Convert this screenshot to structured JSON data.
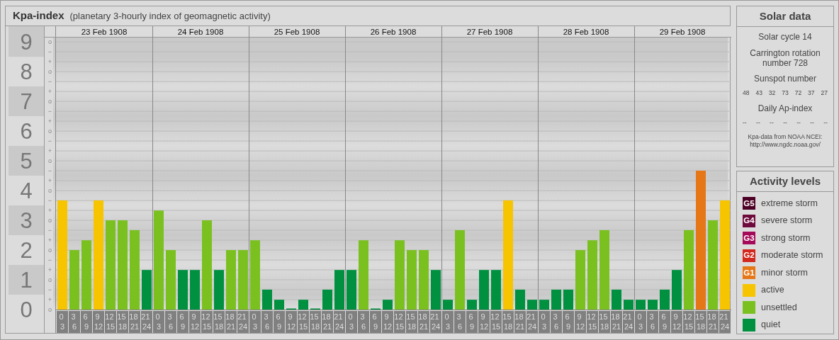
{
  "kpa_panel": {
    "title": "Kpa-index",
    "subtitle": "(planetary 3-hourly index of geomagnetic activity)",
    "days": [
      "23 Feb 1908",
      "24 Feb 1908",
      "25 Feb 1908",
      "26 Feb 1908",
      "27 Feb 1908",
      "28 Feb 1908",
      "29 Feb 1908"
    ],
    "minor_tick_labels": [
      "o",
      "−",
      "+",
      "o",
      "−",
      "+",
      "o",
      "−",
      "+",
      "o",
      "−",
      "+",
      "o",
      "−",
      "+",
      "o",
      "−",
      "+",
      "o",
      "−",
      "+",
      "o",
      "−",
      "+",
      "o",
      "−",
      "+",
      "o"
    ],
    "chart_data": {
      "type": "bar",
      "grid": true,
      "ylim": [
        0,
        9.17
      ],
      "yticks": [
        {
          "value": 0,
          "label": "0"
        },
        {
          "value": 1,
          "label": "1"
        },
        {
          "value": 2,
          "label": "2"
        },
        {
          "value": 3,
          "label": "3"
        },
        {
          "value": 4,
          "label": "4"
        },
        {
          "value": 5,
          "label": "5"
        },
        {
          "value": 6,
          "label": "6"
        },
        {
          "value": 7,
          "label": "7"
        },
        {
          "value": 8,
          "label": "8"
        },
        {
          "value": 9,
          "label": "9"
        }
      ],
      "categories": [
        "0 3",
        "3 6",
        "6 9",
        "9 12",
        "12 15",
        "15 18",
        "18 21",
        "21 24",
        "0 3",
        "3 6",
        "6 9",
        "9 12",
        "12 15",
        "15 18",
        "18 21",
        "21 24",
        "0 3",
        "3 6",
        "6 9",
        "9 12",
        "12 15",
        "15 18",
        "18 21",
        "21 24",
        "0 3",
        "3 6",
        "6 9",
        "9 12",
        "12 15",
        "15 18",
        "18 21",
        "21 24",
        "0 3",
        "3 6",
        "6 9",
        "9 12",
        "12 15",
        "15 18",
        "18 21",
        "21 24",
        "0 3",
        "3 6",
        "6 9",
        "9 12",
        "12 15",
        "15 18",
        "18 21",
        "21 24",
        "0 3",
        "3 6",
        "6 9",
        "9 12",
        "12 15",
        "15 18",
        "18 21",
        "21 24"
      ],
      "series": [
        {
          "color": "#009140",
          "values": [
            null,
            null,
            null,
            null,
            null,
            null,
            null,
            1.33,
            null,
            null,
            1.33,
            1.33,
            null,
            1.33,
            null,
            null,
            null,
            0.67,
            0.33,
            0,
            0.33,
            0,
            0.67,
            1.33,
            1.33,
            null,
            0,
            0.33,
            null,
            null,
            null,
            1.33,
            0.33,
            null,
            0.33,
            1.33,
            1.33,
            null,
            0.67,
            0.33,
            0.33,
            0.67,
            0.67,
            null,
            null,
            null,
            0.67,
            0.33,
            0.33,
            0.33,
            0.67,
            1.33,
            null,
            null,
            null,
            null
          ]
        },
        {
          "color": "#7ac120",
          "values": [
            null,
            2,
            2.33,
            null,
            3,
            3,
            2.67,
            null,
            3.33,
            2,
            null,
            null,
            3,
            null,
            2,
            2,
            2.33,
            null,
            null,
            null,
            null,
            null,
            null,
            null,
            null,
            2.33,
            null,
            null,
            2.33,
            2,
            2,
            null,
            null,
            2.67,
            null,
            null,
            null,
            null,
            null,
            null,
            null,
            null,
            null,
            2,
            2.33,
            2.67,
            null,
            null,
            null,
            null,
            null,
            null,
            2.67,
            null,
            3,
            null
          ]
        },
        {
          "color": "#f7c400",
          "values": [
            3.67,
            null,
            null,
            3.67,
            null,
            null,
            null,
            null,
            null,
            null,
            null,
            null,
            null,
            null,
            null,
            null,
            null,
            null,
            null,
            null,
            null,
            null,
            null,
            null,
            null,
            null,
            null,
            null,
            null,
            null,
            null,
            null,
            null,
            null,
            null,
            null,
            null,
            3.67,
            null,
            null,
            null,
            null,
            null,
            null,
            null,
            null,
            null,
            null,
            null,
            null,
            null,
            null,
            null,
            null,
            null,
            3.67
          ]
        },
        {
          "color": "#e57717",
          "values": [
            null,
            null,
            null,
            null,
            null,
            null,
            null,
            null,
            null,
            null,
            null,
            null,
            null,
            null,
            null,
            null,
            null,
            null,
            null,
            null,
            null,
            null,
            null,
            null,
            null,
            null,
            null,
            null,
            null,
            null,
            null,
            null,
            null,
            null,
            null,
            null,
            null,
            null,
            null,
            null,
            null,
            null,
            null,
            null,
            null,
            null,
            null,
            null,
            null,
            null,
            null,
            null,
            null,
            4.67,
            null,
            null
          ]
        }
      ]
    }
  },
  "solar_data": {
    "title": "Solar data",
    "solar_cycle": "Solar cycle 14",
    "carrington_rotation": "Carrington rotation number 728",
    "sunspot_heading": "Sunspot number",
    "sunspot_numbers": [
      "48",
      "43",
      "32",
      "73",
      "72",
      "37",
      "27"
    ],
    "ap_heading": "Daily Ap-index",
    "ap_values": [
      "--",
      "--",
      "--",
      "--",
      "--",
      "--",
      "--"
    ],
    "credit": "Kpa-data from NOAA NCEI:",
    "credit_url": "http://www.ngdc.noaa.gov/"
  },
  "activity_levels": {
    "title": "Activity levels",
    "items": [
      {
        "badge": "G5",
        "label": "extreme storm",
        "color": "#4d0025"
      },
      {
        "badge": "G4",
        "label": "severe storm",
        "color": "#6e0a3c"
      },
      {
        "badge": "G3",
        "label": "strong storm",
        "color": "#a50a5a"
      },
      {
        "badge": "G2",
        "label": "moderate storm",
        "color": "#d2281e"
      },
      {
        "badge": "G1",
        "label": "minor storm",
        "color": "#e57717"
      },
      {
        "label": "active",
        "color": "#f7c400"
      },
      {
        "label": "unsettled",
        "color": "#7ac120"
      },
      {
        "label": "quiet",
        "color": "#009140"
      }
    ]
  }
}
